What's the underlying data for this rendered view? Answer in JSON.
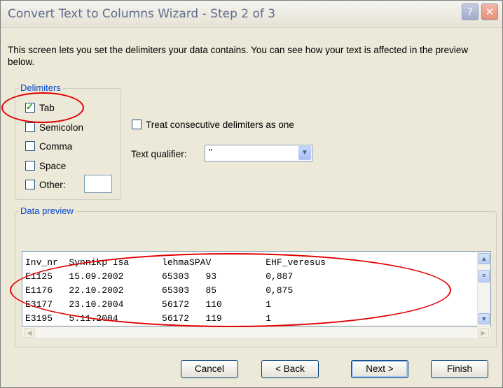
{
  "window": {
    "title": "Convert Text to Columns Wizard - Step 2 of 3",
    "help_glyph": "?",
    "close_glyph": "✕"
  },
  "description": "This screen lets you set the delimiters your data contains.  You can see how your text is affected in the preview below.",
  "delimiters": {
    "legend": "Delimiters",
    "items": [
      {
        "label": "Tab",
        "checked": true
      },
      {
        "label": "Semicolon",
        "checked": false
      },
      {
        "label": "Comma",
        "checked": false
      },
      {
        "label": "Space",
        "checked": false
      },
      {
        "label": "Other:",
        "checked": false
      }
    ],
    "other_value": ""
  },
  "consecutive": {
    "label": "Treat consecutive delimiters as one",
    "checked": false
  },
  "qualifier": {
    "label": "Text qualifier:",
    "value": "\""
  },
  "preview": {
    "legend": "Data preview",
    "rows": [
      "Inv_nr  Synnikp Isa      lehmaSPAV          EHF_veresus",
      "E1125   15.09.2002       65303   93         0,887",
      "E1176   22.10.2002       65303   85         0,875",
      "E3177   23.10.2004       56172   110        1",
      "E3195   5.11.2004        56172   119        1"
    ]
  },
  "buttons": {
    "cancel": "Cancel",
    "back": "< Back",
    "next": "Next >",
    "finish": "Finish"
  },
  "colors": {
    "annotation": "#e00000",
    "legend_text": "#0046d5",
    "check": "#21a121"
  }
}
